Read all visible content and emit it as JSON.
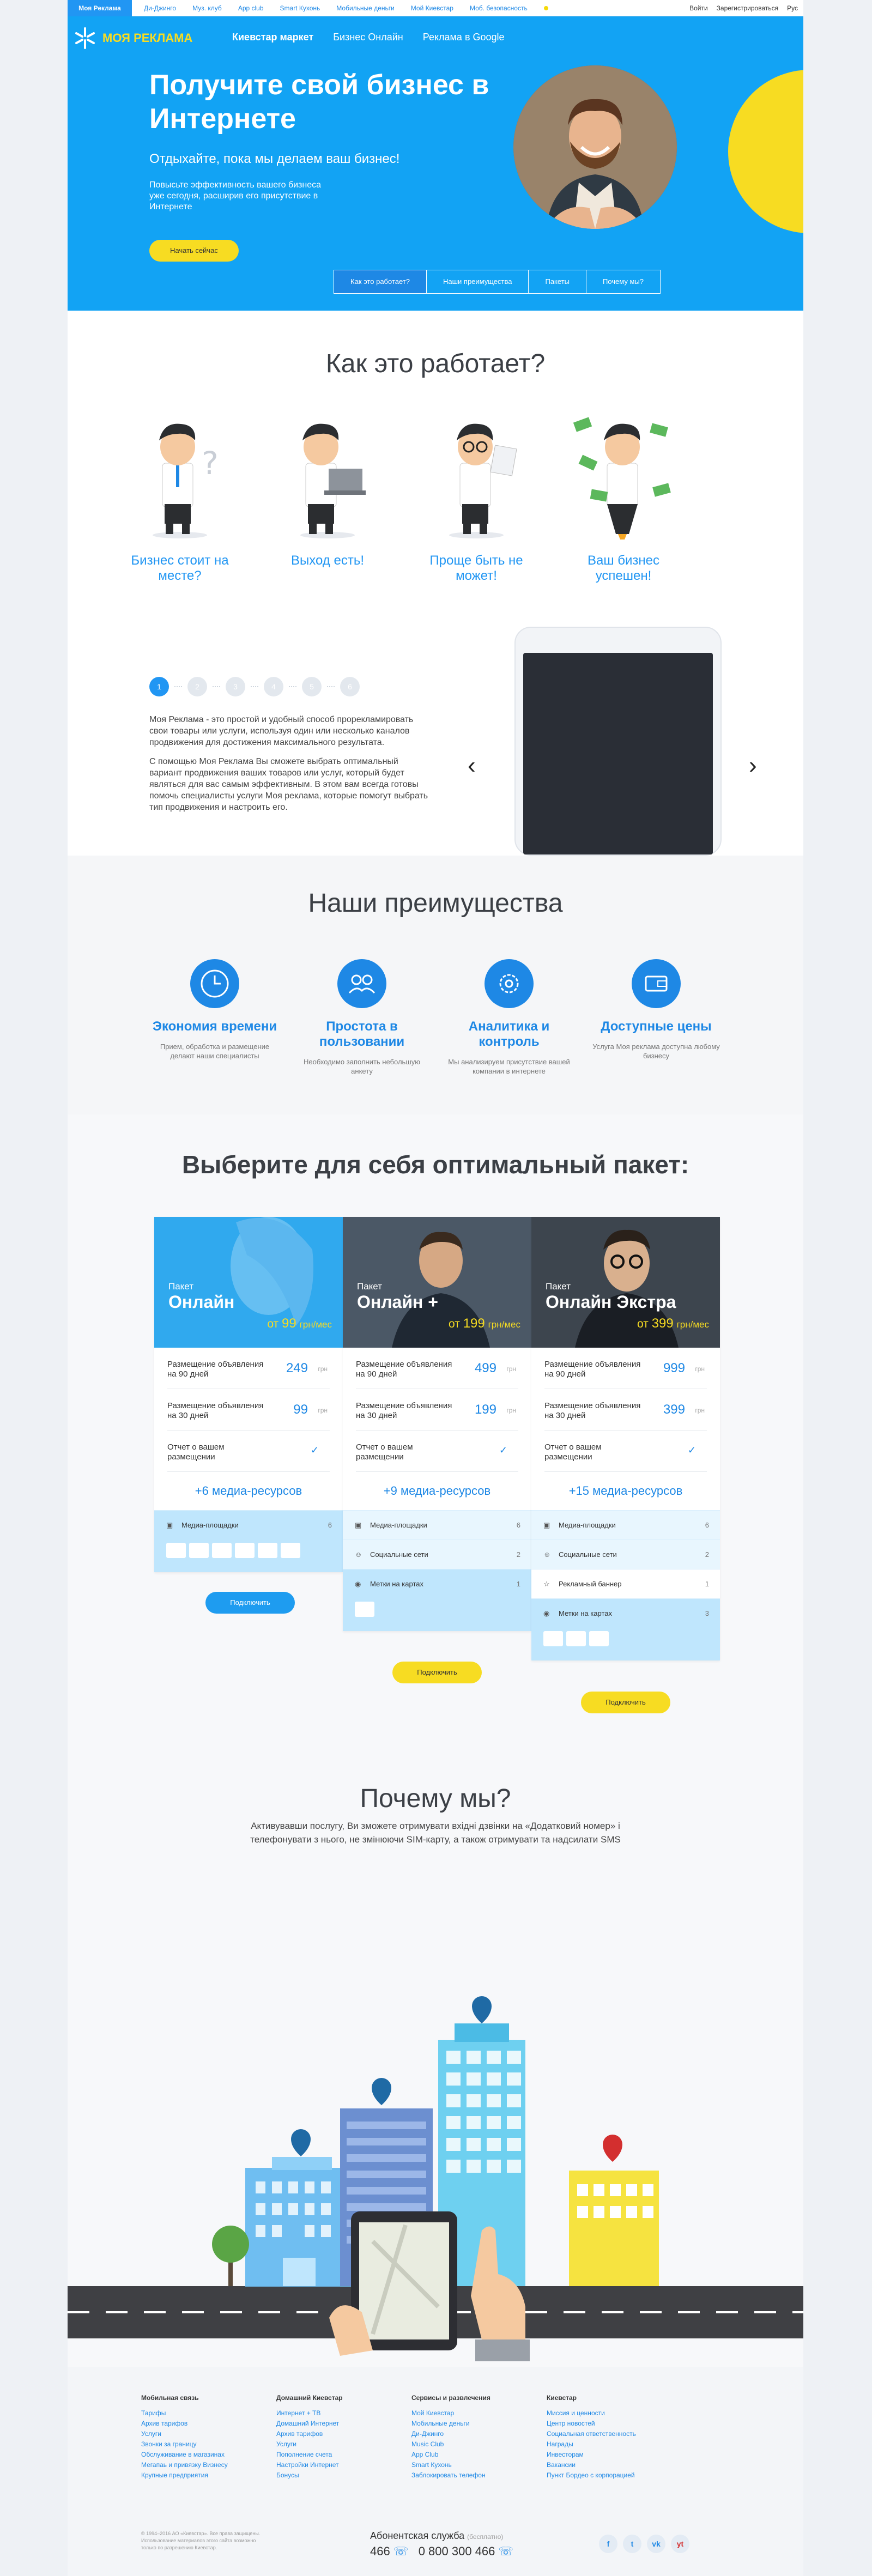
{
  "topbar": {
    "brand": "Моя Реклама",
    "links": [
      "Ди-Джинго",
      "Муз. клуб",
      "App club",
      "Smart Кухонь",
      "Мобильные деньги",
      "Мой Киевстар",
      "Моб. безопасность"
    ],
    "right": [
      "Войти",
      "Зарегистрироваться",
      "Рус"
    ]
  },
  "hero": {
    "logo": "МОЯ РЕКЛАМА",
    "nav": [
      "Киевстар маркет",
      "Бизнес Онлайн",
      "Реклама в Google"
    ],
    "title": "Получите свой бизнес в Интернете",
    "subtitle": "Отдыхайте, пока мы делаем ваш бизнес!",
    "description": "Повысьте эффективность вашего бизнеса уже сегодня, расширив его присутствие в Интернете",
    "cta": "Начать сейчас",
    "tabs": [
      "Как это работает?",
      "Наши преимущества",
      "Пакеты",
      "Почему мы?"
    ]
  },
  "how": {
    "title": "Как это работает?",
    "steps": [
      "Бизнес стоит на месте?",
      "Выход есть!",
      "Проще быть не может!",
      "Ваш бизнес успешен!"
    ],
    "pager": [
      "1",
      "2",
      "3",
      "4",
      "5",
      "6"
    ],
    "text": [
      "Моя Реклама - это простой и удобный способ прорекламировать свои товары или услуги, используя один или несколько каналов продвижения для достижения максимального результата.",
      "С помощью Моя Реклама Вы сможете выбрать оптимальный вариант продвижения ваших товаров или услуг, который будет являться для вас самым эффективным. В этом вам всегда готовы помочь специалисты услуги Моя реклама, которые помогут выбрать тип продвижения и настроить его."
    ],
    "prev": "‹",
    "next": "›"
  },
  "advantages": {
    "title": "Наши преимущества",
    "items": [
      {
        "title": "Экономия времени",
        "desc": "Прием, обработка и размещение делают наши специалисты"
      },
      {
        "title": "Простота в пользовании",
        "desc": "Необходимо заполнить небольшую анкету"
      },
      {
        "title": "Аналитика и контроль",
        "desc": "Мы анализируем присутствие вашей компании в интернете"
      },
      {
        "title": "Доступные цены",
        "desc": "Услуга Моя реклама доступна любому бизнесу"
      }
    ]
  },
  "packages": {
    "title": "Выберите для себя оптимальный пакет:",
    "label": "Пакет",
    "button": "Подключить",
    "cards": [
      {
        "name": "Онлайн",
        "price_prefix": "от",
        "price": "99",
        "price_unit": "грн/мес",
        "rows": [
          {
            "label": "Размещение объявления на 90 дней",
            "value": "249",
            "unit": "грн"
          },
          {
            "label": "Размещение объявления на 30 дней",
            "value": "99",
            "unit": "грн"
          },
          {
            "label": "Отчет о вашем размещении",
            "check": "✓"
          }
        ],
        "media": "+6 медиа-ресурсов",
        "acc": [
          {
            "label": "Медиа-площадки",
            "count": "6",
            "icon": "▣",
            "open": true
          }
        ]
      },
      {
        "name": "Онлайн +",
        "price_prefix": "от",
        "price": "199",
        "price_unit": "грн/мес",
        "rows": [
          {
            "label": "Размещение объявления на 90 дней",
            "value": "499",
            "unit": "грн"
          },
          {
            "label": "Размещение объявления на 30 дней",
            "value": "199",
            "unit": "грн"
          },
          {
            "label": "Отчет о вашем размещении",
            "check": "✓"
          }
        ],
        "media": "+9 медиа-ресурсов",
        "acc": [
          {
            "label": "Медиа-площадки",
            "count": "6",
            "icon": "▣"
          },
          {
            "label": "Социальные сети",
            "count": "2",
            "icon": "☺"
          },
          {
            "label": "Метки на картах",
            "count": "1",
            "icon": "◉",
            "open": true
          }
        ]
      },
      {
        "name": "Онлайн Экстра",
        "price_prefix": "от",
        "price": "399",
        "price_unit": "грн/мес",
        "rows": [
          {
            "label": "Размещение объявления на 90 дней",
            "value": "999",
            "unit": "грн"
          },
          {
            "label": "Размещение объявления на 30 дней",
            "value": "399",
            "unit": "грн"
          },
          {
            "label": "Отчет о вашем размещении",
            "check": "✓"
          }
        ],
        "media": "+15 медиа-ресурсов",
        "acc": [
          {
            "label": "Медиа-площадки",
            "count": "6",
            "icon": "▣"
          },
          {
            "label": "Социальные сети",
            "count": "2",
            "icon": "☺"
          },
          {
            "label": "Рекламный баннер",
            "count": "1",
            "icon": "☆"
          },
          {
            "label": "Метки на картах",
            "count": "3",
            "icon": "◉",
            "open": true
          }
        ]
      }
    ]
  },
  "why": {
    "title": "Почему мы?",
    "text": "Активувавши послугу, Ви зможете отримувати вхідні дзвінки на «Додатковий номер» і телефонувати з нього, не змінюючи SIM-карту, а також отримувати та надсилати SMS"
  },
  "footer": {
    "columns": [
      {
        "head": "Мобильная связь",
        "links": [
          "Тарифы",
          "Архив тарифов",
          "Услуги",
          "Звонки за границу",
          "Обслуживание в магазинах",
          "Мегапаь и привязку Визнесу",
          "Крупные предприятия"
        ]
      },
      {
        "head": "Домашний Киевстар",
        "links": [
          "Интернет + ТВ",
          "Домашний Интернет",
          "Архив тарифов",
          "Услуги",
          "Пополнение счета",
          "Настройки Интернет",
          "Бонусы"
        ]
      },
      {
        "head": "Сервисы и развлечения",
        "links": [
          "Мой Киевстар",
          "Мобильные деньги",
          "Ди-Джинго",
          "Music Club",
          "App Club",
          "Smart Кухонь",
          "Заблокировать телефон"
        ]
      },
      {
        "head": "Киевстар",
        "links": [
          "Миссия и ценности",
          "Центр новостей",
          "Социальная ответственность",
          "Награды",
          "Инвесторам",
          "Вакансии",
          "Пункт Бордео с корпорацией"
        ]
      }
    ],
    "copy": "© 1994–2016 АО «Киевстар». Все права защищены. Использование материалов этого сайта возможно только по разрешению Киевстар.",
    "service": "Абонентская служба",
    "service_note": "(бесплатно)",
    "number_short": "466",
    "number_long": "0 800 300 466",
    "social": [
      "f",
      "t",
      "vk",
      "yt"
    ]
  },
  "colors": {
    "brand": "#12a3f4",
    "accent": "#f7dc22",
    "link": "#1e88e5"
  }
}
